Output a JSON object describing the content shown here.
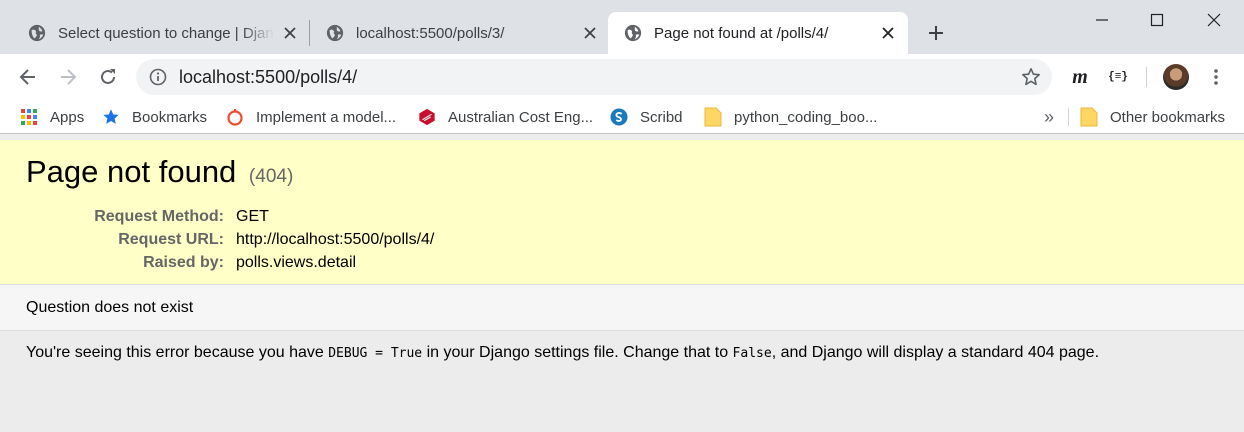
{
  "browser": {
    "tabs": [
      {
        "title": "Select question to change | Django site admin",
        "close": "✕"
      },
      {
        "title": "localhost:5500/polls/3/",
        "close": "✕"
      },
      {
        "title": "Page not found at /polls/4/",
        "close": "✕"
      }
    ],
    "url": "localhost:5500/polls/4/",
    "ext_m": "m",
    "ext_json": "{≡}",
    "bookmarks": [
      {
        "label": "Apps",
        "icon": "apps-grid-icon"
      },
      {
        "label": "Bookmarks",
        "icon": "star-icon"
      },
      {
        "label": "Implement a model...",
        "icon": "ring-icon"
      },
      {
        "label": "Australian Cost Eng...",
        "icon": "red-cube-icon"
      },
      {
        "label": "Scribd",
        "icon": "scribd-icon"
      },
      {
        "label": "python_coding_boo...",
        "icon": "folder-icon"
      }
    ],
    "bookmarks_overflow": "»",
    "other_bookmarks": "Other bookmarks"
  },
  "error_page": {
    "title": "Page not found",
    "code": "(404)",
    "meta": [
      {
        "key": "Request Method:",
        "value": "GET"
      },
      {
        "key": "Request URL:",
        "value": "http://localhost:5500/polls/4/"
      },
      {
        "key": "Raised by:",
        "value": "polls.views.detail"
      }
    ],
    "reason": "Question does not exist",
    "explanation": {
      "part1": "You're seeing this error because you have ",
      "code1": "DEBUG = True",
      "part2": " in your Django settings file. Change that to ",
      "code2": "False",
      "part3": ", and Django will display a standard 404 page."
    }
  },
  "colors": {
    "summary_bg": "#ffffc8",
    "info_bg": "#f6f6f6",
    "page_bg": "#ececec",
    "tabstrip_bg": "#dee1e6"
  }
}
